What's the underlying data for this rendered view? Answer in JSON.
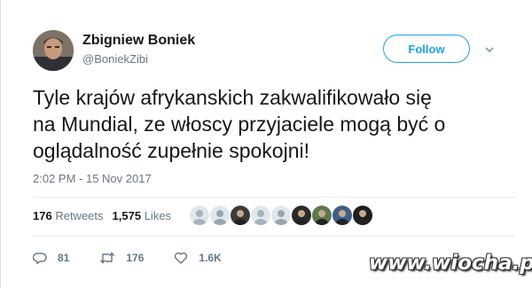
{
  "author": {
    "display_name": "Zbigniew Boniek",
    "handle": "@BoniekZibi"
  },
  "follow_button": {
    "label": "Follow"
  },
  "tweet": {
    "text_lines": [
      "Tyle krajów afrykanskich zakwalifikowało się",
      "na Mundial, ze włoscy przyjaciele mogą być o",
      "oglądalność zupełnie spokojni!"
    ],
    "timestamp": "2:02 PM - 15 Nov 2017"
  },
  "stats": {
    "retweets_count": "176",
    "retweets_label": "Retweets",
    "likes_count": "1,575",
    "likes_label": "Likes"
  },
  "likers": [
    {
      "icon": "default-avatar",
      "color": "#a8b3bc"
    },
    {
      "icon": "default-avatar",
      "color": "#9aa6b0"
    },
    {
      "icon": "photo-avatar",
      "color": "#3b3b3b"
    },
    {
      "icon": "default-avatar",
      "color": "#a8b3bc"
    },
    {
      "icon": "default-avatar",
      "color": "#9aa6b0"
    },
    {
      "icon": "photo-avatar",
      "color": "#2a2a2a"
    },
    {
      "icon": "photo-avatar",
      "color": "#5a7a4e"
    },
    {
      "icon": "photo-avatar",
      "color": "#3e5f8a"
    },
    {
      "icon": "photo-avatar",
      "color": "#1f1f1f"
    }
  ],
  "actions": {
    "reply_count": "81",
    "retweet_count": "176",
    "like_count": "1.6K"
  },
  "watermark": "www.wiocha.pl",
  "colors": {
    "accent": "#1da1f2",
    "text": "#14171a",
    "secondary": "#657786",
    "divider": "#e6ecf0"
  }
}
